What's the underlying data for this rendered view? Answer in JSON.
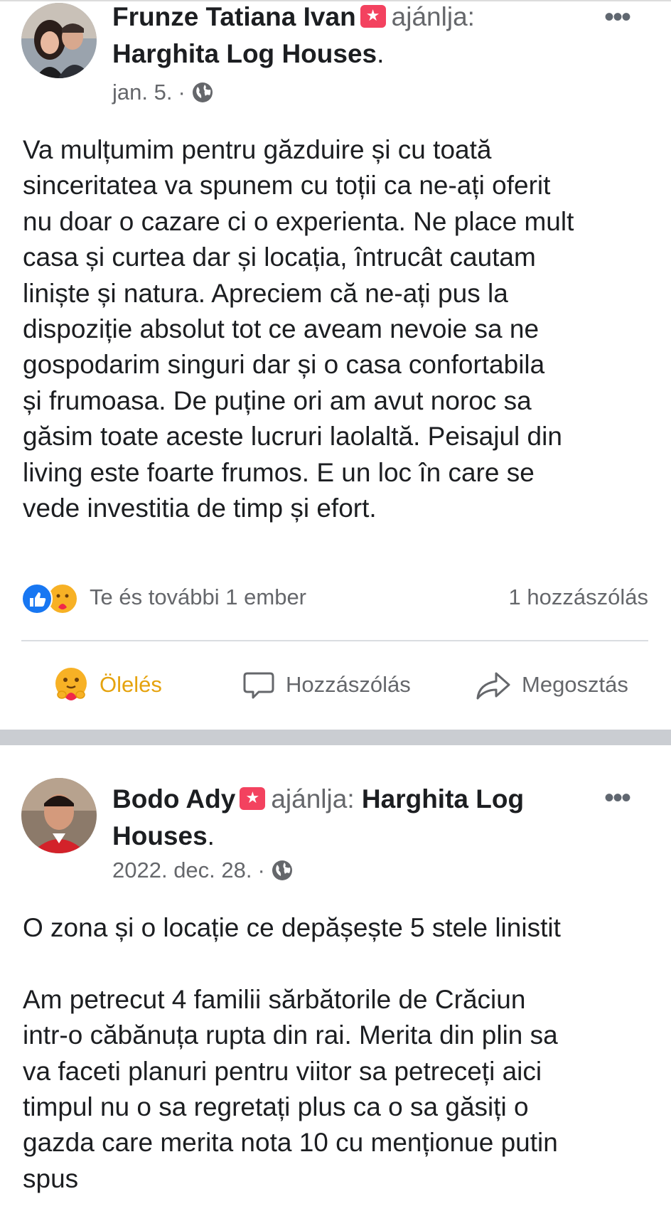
{
  "posts": [
    {
      "author": "Frunze Tatiana Ivan",
      "recommends_label": "ajánlja:",
      "page": "Harghita Log Houses",
      "date": "jan. 5.",
      "separator": "·",
      "body": "Va mulțumim pentru găzduire și cu toată\nsinceritatea va spunem cu toții ca ne-ați oferit\nnu doar o cazare ci o experienta. Ne place mult\ncasa și curtea dar și locația, întrucât cautam\nliniște și natura. Apreciem că ne-ați pus la\ndispoziție absolut tot ce aveam nevoie sa ne\ngospodarim singuri dar și o casa confortabila\nși frumoasa. De puține ori am avut noroc sa\ngăsim toate aceste lucruri laolaltă. Peisajul din\nliving este foarte frumos. E un loc în care se\nvede investitia de timp și efort.",
      "reactions_text": "Te és további 1 ember",
      "comments_count": "1 hozzászólás",
      "actions": {
        "react": "Ölelés",
        "comment": "Hozzászólás",
        "share": "Megosztás"
      }
    },
    {
      "author": "Bodo Ady",
      "recommends_label": "ajánlja:",
      "page_line1": "Harghita Log",
      "page_line2": "Houses",
      "date": "2022. dec. 28.",
      "separator": "·",
      "body": "O zona și o locație ce depășește 5 stele linistit\n\nAm petrecut 4 familii sărbătorile de Crăciun\nintr-o căbănuța rupta din rai. Merita din plin sa\nva faceti planuri pentru viitor sa petreceți aici\ntimpul nu o sa regretați plus ca o sa găsiți o\ngazda care merita nota 10 cu menționue putin\nspus"
    }
  ],
  "icons": {
    "recommend": "recommend-badge-icon",
    "globe": "globe-icon",
    "more": "more-options-icon",
    "like": "like-reaction-icon",
    "care": "care-reaction-icon",
    "comment": "comment-bubble-icon",
    "share": "share-arrow-icon"
  },
  "colors": {
    "like": "#1877f2",
    "care": "#f7b125",
    "recommend": "#f3425f",
    "muted": "#65676b"
  }
}
